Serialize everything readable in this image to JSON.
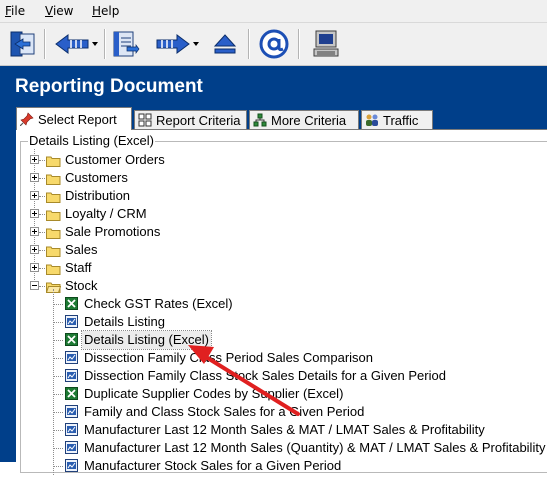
{
  "menu": {
    "items": [
      {
        "label": "File"
      },
      {
        "label": "View"
      },
      {
        "label": "Help"
      }
    ]
  },
  "toolbar": {
    "buttons": [
      {
        "icon": "exit-icon"
      },
      {
        "icon": "back-arrow-icon"
      },
      {
        "icon": "document-icon"
      },
      {
        "icon": "forward-arrow-icon"
      },
      {
        "icon": "eject-icon"
      },
      {
        "icon": "email-at-icon"
      },
      {
        "icon": "computer-icon"
      }
    ]
  },
  "window": {
    "title": "Reporting Document"
  },
  "tabs": [
    {
      "label": "Select Report",
      "active": true,
      "icon": "pin-icon"
    },
    {
      "label": "Report Criteria",
      "active": false,
      "icon": "grid-icon"
    },
    {
      "label": "More Criteria",
      "active": false,
      "icon": "network-icon"
    },
    {
      "label": "Traffic",
      "active": false,
      "icon": "people-icon"
    }
  ],
  "group": {
    "title": "Details Listing (Excel)"
  },
  "tree": {
    "folders": [
      {
        "label": "Customer Orders",
        "expanded": false
      },
      {
        "label": "Customers",
        "expanded": false
      },
      {
        "label": "Distribution",
        "expanded": false
      },
      {
        "label": "Loyalty / CRM",
        "expanded": false
      },
      {
        "label": "Sale Promotions",
        "expanded": false
      },
      {
        "label": "Sales",
        "expanded": false
      },
      {
        "label": "Staff",
        "expanded": false
      },
      {
        "label": "Stock",
        "expanded": true
      }
    ],
    "stock_reports": [
      {
        "label": "Check GST Rates (Excel)",
        "type": "excel"
      },
      {
        "label": "Details Listing",
        "type": "report"
      },
      {
        "label": "Details Listing (Excel)",
        "type": "excel",
        "selected": true
      },
      {
        "label": "Dissection Family Class Period Sales Comparison",
        "type": "report"
      },
      {
        "label": "Dissection Family Class Stock Sales Details for a Given Period",
        "type": "report"
      },
      {
        "label": "Duplicate Supplier Codes by Supplier (Excel)",
        "type": "excel"
      },
      {
        "label": "Family and Class Stock Sales for a Given Period",
        "type": "report"
      },
      {
        "label": "Manufacturer Last 12 Month Sales & MAT / LMAT Sales & Profitability",
        "type": "report"
      },
      {
        "label": "Manufacturer Last 12 Month Sales (Quantity) & MAT / LMAT Sales & Profitability",
        "type": "report"
      },
      {
        "label": "Manufacturer Stock Sales for a Given Period",
        "type": "report"
      }
    ]
  },
  "colors": {
    "header_bg": "#003f8a",
    "annotation_arrow": "#e02020",
    "excel_green": "#1d7a33",
    "report_blue": "#2a5db0",
    "folder_yellow": "#f7d96b"
  }
}
